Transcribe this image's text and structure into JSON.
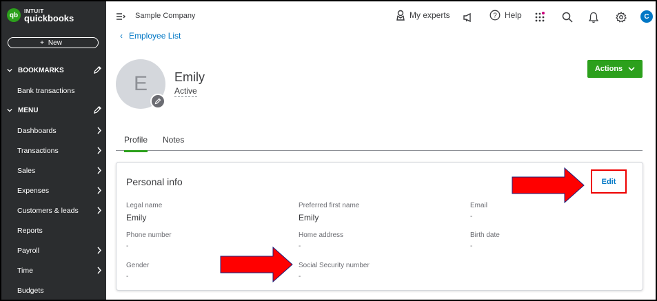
{
  "brand": {
    "badge": "qb",
    "top": "INTUIT",
    "name": "quickbooks"
  },
  "sidebar": {
    "new_label": "New",
    "bookmarks_label": "BOOKMARKS",
    "bookmark_items": [
      "Bank transactions"
    ],
    "menu_label": "MENU",
    "menu_items": [
      "Dashboards",
      "Transactions",
      "Sales",
      "Expenses",
      "Customers & leads",
      "Reports",
      "Payroll",
      "Time",
      "Budgets"
    ]
  },
  "topbar": {
    "company": "Sample Company",
    "my_experts": "My experts",
    "help": "Help",
    "user_initial": "C"
  },
  "breadcrumb": {
    "back_label": "Employee List"
  },
  "employee": {
    "initial": "E",
    "name": "Emily",
    "status": "Active"
  },
  "actions_label": "Actions",
  "tabs": [
    "Profile",
    "Notes"
  ],
  "personal_info": {
    "title": "Personal info",
    "edit_label": "Edit",
    "fields": [
      {
        "label": "Legal name",
        "value": "Emily"
      },
      {
        "label": "Preferred first name",
        "value": "Emily"
      },
      {
        "label": "Email",
        "value": "-"
      },
      {
        "label": "Phone number",
        "value": "-"
      },
      {
        "label": "Home address",
        "value": "-"
      },
      {
        "label": "Birth date",
        "value": "-"
      },
      {
        "label": "Gender",
        "value": "-"
      },
      {
        "label": "Social Security number",
        "value": "-"
      }
    ]
  },
  "colors": {
    "sidebar": "#2b2d2f",
    "accent_green": "#2ca01c",
    "link_blue": "#0077c5",
    "annotation_red": "#ff0000"
  },
  "icons": [
    "pencil-icon",
    "chevron-down-icon",
    "chevron-right-icon",
    "hamburger-icon",
    "experts-icon",
    "megaphone-icon",
    "help-icon",
    "apps-icon",
    "search-icon",
    "bell-icon",
    "gear-icon"
  ]
}
